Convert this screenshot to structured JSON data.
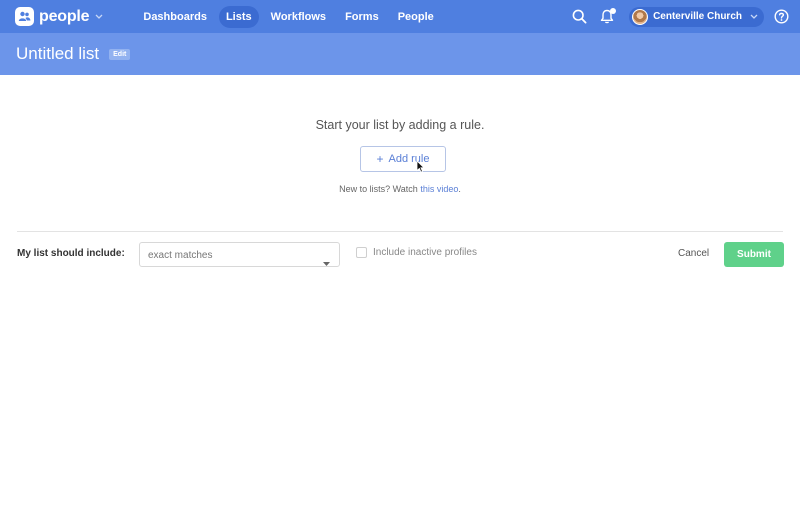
{
  "app": {
    "name": "people"
  },
  "nav": {
    "items": [
      "Dashboards",
      "Lists",
      "Workflows",
      "Forms",
      "People"
    ],
    "active": "Lists"
  },
  "org": {
    "name": "Centerville Church"
  },
  "page": {
    "title": "Untitled list",
    "edit_label": "Edit"
  },
  "empty_state": {
    "message": "Start your list by adding a rule.",
    "add_rule_label": "Add rule",
    "help_prefix": "New to lists? Watch ",
    "help_link": "this video",
    "help_suffix": "."
  },
  "rules": {
    "include_label": "My list should include:",
    "match_value": "exact matches",
    "inactive_label": "Include inactive profiles",
    "inactive_checked": false,
    "cancel_label": "Cancel",
    "submit_label": "Submit"
  },
  "colors": {
    "brand": "#4f7fe0",
    "subheader": "#6c95ea",
    "submit": "#5fd18a",
    "link": "#5a7fd6"
  }
}
